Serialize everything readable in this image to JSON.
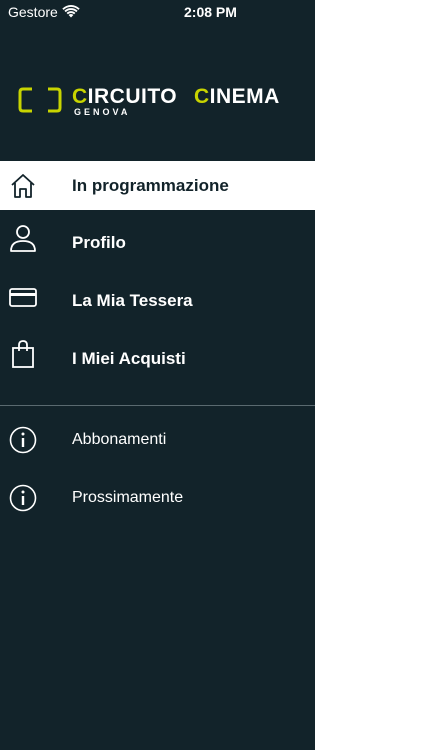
{
  "status_bar": {
    "carrier": "Gestore",
    "time": "2:08 PM"
  },
  "logo": {
    "word1_accent": "C",
    "word1_rest": "IRCUITO",
    "word2_accent": "C",
    "word2_rest": "INEMA",
    "subtitle": "GENOVA",
    "accent_color": "#c8d400"
  },
  "menu": {
    "primary": [
      {
        "label": "In programmazione",
        "icon": "home-icon",
        "active": true
      },
      {
        "label": "Profilo",
        "icon": "user-icon",
        "active": false
      },
      {
        "label": "La Mia Tessera",
        "icon": "card-icon",
        "active": false
      },
      {
        "label": "I Miei Acquisti",
        "icon": "shopping-bag-icon",
        "active": false
      }
    ],
    "secondary": [
      {
        "label": "Abbonamenti",
        "icon": "info-icon"
      },
      {
        "label": "Prossimamente",
        "icon": "info-icon"
      }
    ]
  },
  "colors": {
    "drawer_bg": "#12232a",
    "active_bg": "#ffffff",
    "accent": "#c8d400"
  }
}
